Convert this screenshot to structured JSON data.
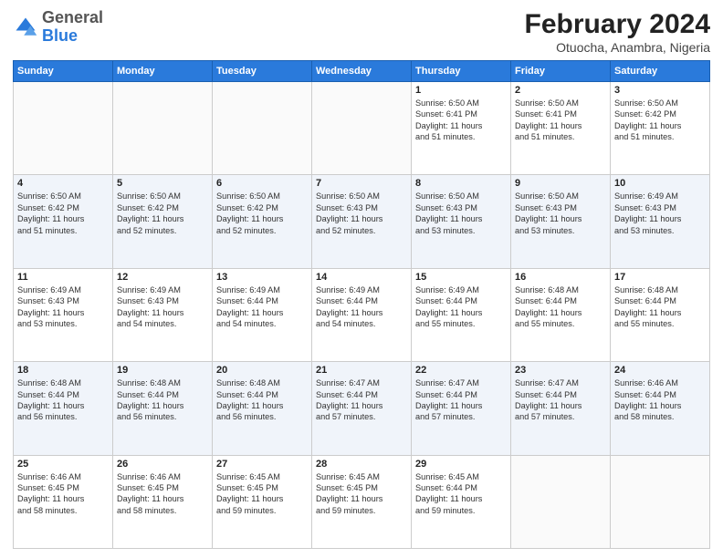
{
  "header": {
    "logo": {
      "line1": "General",
      "line2": "Blue"
    },
    "title": "February 2024",
    "subtitle": "Otuocha, Anambra, Nigeria"
  },
  "weekdays": [
    "Sunday",
    "Monday",
    "Tuesday",
    "Wednesday",
    "Thursday",
    "Friday",
    "Saturday"
  ],
  "weeks": [
    [
      {
        "day": "",
        "info": ""
      },
      {
        "day": "",
        "info": ""
      },
      {
        "day": "",
        "info": ""
      },
      {
        "day": "",
        "info": ""
      },
      {
        "day": "1",
        "info": "Sunrise: 6:50 AM\nSunset: 6:41 PM\nDaylight: 11 hours\nand 51 minutes."
      },
      {
        "day": "2",
        "info": "Sunrise: 6:50 AM\nSunset: 6:41 PM\nDaylight: 11 hours\nand 51 minutes."
      },
      {
        "day": "3",
        "info": "Sunrise: 6:50 AM\nSunset: 6:42 PM\nDaylight: 11 hours\nand 51 minutes."
      }
    ],
    [
      {
        "day": "4",
        "info": "Sunrise: 6:50 AM\nSunset: 6:42 PM\nDaylight: 11 hours\nand 51 minutes."
      },
      {
        "day": "5",
        "info": "Sunrise: 6:50 AM\nSunset: 6:42 PM\nDaylight: 11 hours\nand 52 minutes."
      },
      {
        "day": "6",
        "info": "Sunrise: 6:50 AM\nSunset: 6:42 PM\nDaylight: 11 hours\nand 52 minutes."
      },
      {
        "day": "7",
        "info": "Sunrise: 6:50 AM\nSunset: 6:43 PM\nDaylight: 11 hours\nand 52 minutes."
      },
      {
        "day": "8",
        "info": "Sunrise: 6:50 AM\nSunset: 6:43 PM\nDaylight: 11 hours\nand 53 minutes."
      },
      {
        "day": "9",
        "info": "Sunrise: 6:50 AM\nSunset: 6:43 PM\nDaylight: 11 hours\nand 53 minutes."
      },
      {
        "day": "10",
        "info": "Sunrise: 6:49 AM\nSunset: 6:43 PM\nDaylight: 11 hours\nand 53 minutes."
      }
    ],
    [
      {
        "day": "11",
        "info": "Sunrise: 6:49 AM\nSunset: 6:43 PM\nDaylight: 11 hours\nand 53 minutes."
      },
      {
        "day": "12",
        "info": "Sunrise: 6:49 AM\nSunset: 6:43 PM\nDaylight: 11 hours\nand 54 minutes."
      },
      {
        "day": "13",
        "info": "Sunrise: 6:49 AM\nSunset: 6:44 PM\nDaylight: 11 hours\nand 54 minutes."
      },
      {
        "day": "14",
        "info": "Sunrise: 6:49 AM\nSunset: 6:44 PM\nDaylight: 11 hours\nand 54 minutes."
      },
      {
        "day": "15",
        "info": "Sunrise: 6:49 AM\nSunset: 6:44 PM\nDaylight: 11 hours\nand 55 minutes."
      },
      {
        "day": "16",
        "info": "Sunrise: 6:48 AM\nSunset: 6:44 PM\nDaylight: 11 hours\nand 55 minutes."
      },
      {
        "day": "17",
        "info": "Sunrise: 6:48 AM\nSunset: 6:44 PM\nDaylight: 11 hours\nand 55 minutes."
      }
    ],
    [
      {
        "day": "18",
        "info": "Sunrise: 6:48 AM\nSunset: 6:44 PM\nDaylight: 11 hours\nand 56 minutes."
      },
      {
        "day": "19",
        "info": "Sunrise: 6:48 AM\nSunset: 6:44 PM\nDaylight: 11 hours\nand 56 minutes."
      },
      {
        "day": "20",
        "info": "Sunrise: 6:48 AM\nSunset: 6:44 PM\nDaylight: 11 hours\nand 56 minutes."
      },
      {
        "day": "21",
        "info": "Sunrise: 6:47 AM\nSunset: 6:44 PM\nDaylight: 11 hours\nand 57 minutes."
      },
      {
        "day": "22",
        "info": "Sunrise: 6:47 AM\nSunset: 6:44 PM\nDaylight: 11 hours\nand 57 minutes."
      },
      {
        "day": "23",
        "info": "Sunrise: 6:47 AM\nSunset: 6:44 PM\nDaylight: 11 hours\nand 57 minutes."
      },
      {
        "day": "24",
        "info": "Sunrise: 6:46 AM\nSunset: 6:44 PM\nDaylight: 11 hours\nand 58 minutes."
      }
    ],
    [
      {
        "day": "25",
        "info": "Sunrise: 6:46 AM\nSunset: 6:45 PM\nDaylight: 11 hours\nand 58 minutes."
      },
      {
        "day": "26",
        "info": "Sunrise: 6:46 AM\nSunset: 6:45 PM\nDaylight: 11 hours\nand 58 minutes."
      },
      {
        "day": "27",
        "info": "Sunrise: 6:45 AM\nSunset: 6:45 PM\nDaylight: 11 hours\nand 59 minutes."
      },
      {
        "day": "28",
        "info": "Sunrise: 6:45 AM\nSunset: 6:45 PM\nDaylight: 11 hours\nand 59 minutes."
      },
      {
        "day": "29",
        "info": "Sunrise: 6:45 AM\nSunset: 6:44 PM\nDaylight: 11 hours\nand 59 minutes."
      },
      {
        "day": "",
        "info": ""
      },
      {
        "day": "",
        "info": ""
      }
    ]
  ]
}
